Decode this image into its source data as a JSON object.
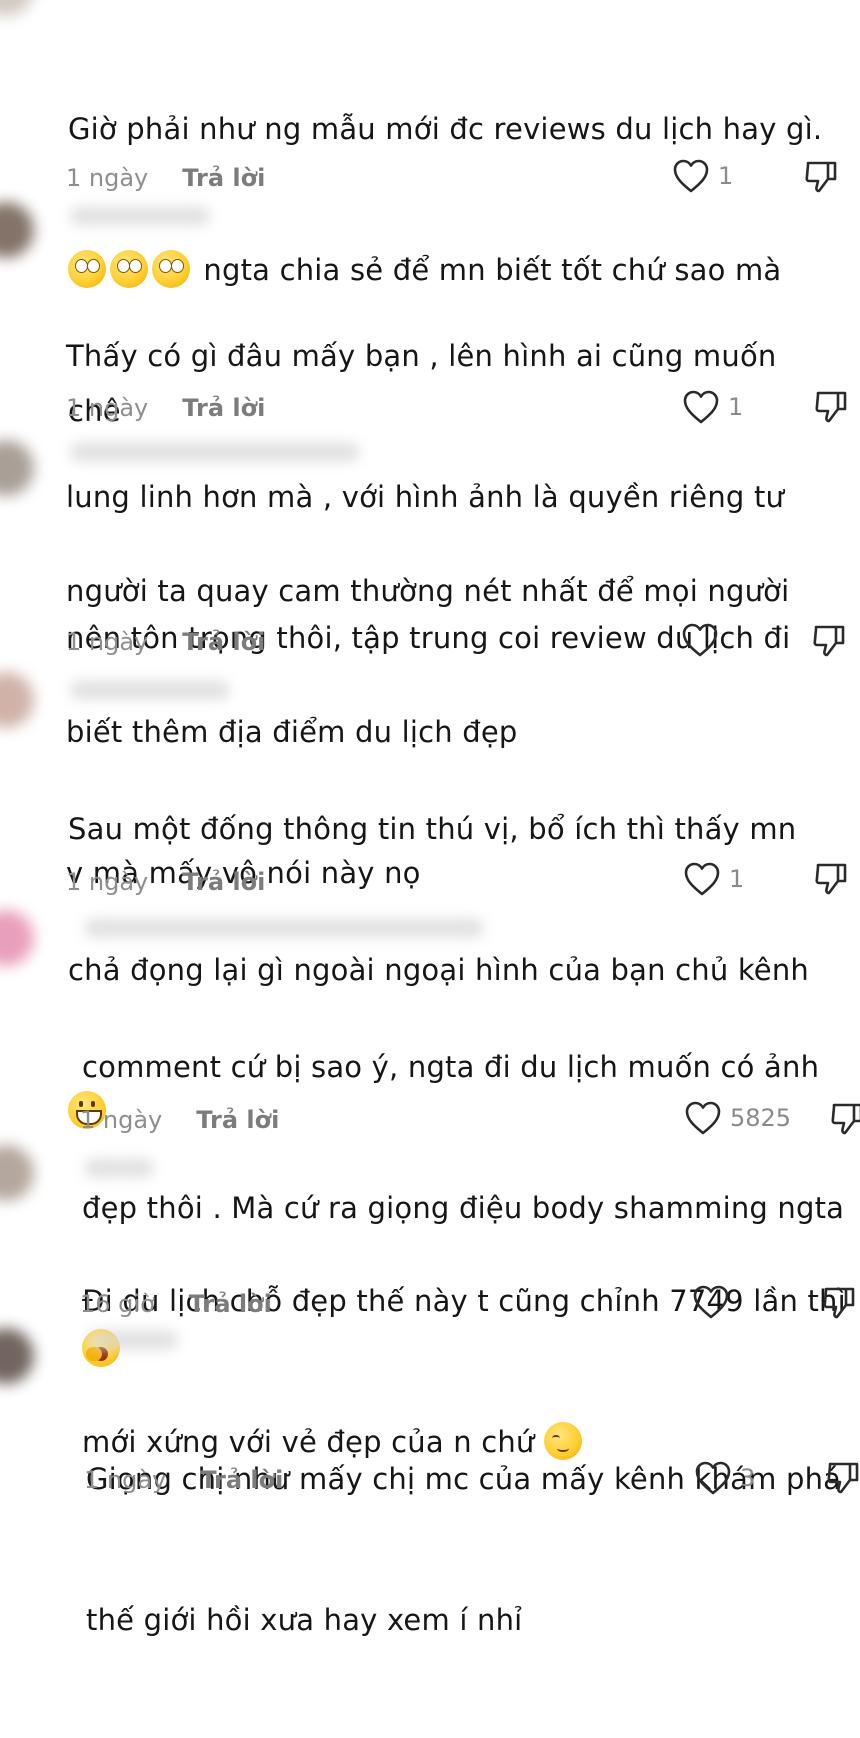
{
  "comments": [
    {
      "lines": [
        "Giờ phải như ng mẫu mới đc reviews du lịch hay gì.",
        "ngta chia sẻ để mn biết tốt chứ sao mà",
        "chê"
      ],
      "emoji_prefix": [
        "face-with-rolling-eyes-emoji",
        "face-with-rolling-eyes-emoji",
        "face-with-rolling-eyes-emoji"
      ],
      "time": "1 ngày",
      "reply": "Trả lời",
      "likes": "1"
    },
    {
      "lines": [
        "Thấy có gì đâu mấy bạn , lên hình ai cũng muốn",
        "lung linh hơn mà , với hình ảnh là quyền riêng tư",
        "nên tôn trọng thôi, tập trung coi review du lịch đi"
      ],
      "time": "1 ngày",
      "reply": "Trả lời",
      "likes": "1"
    },
    {
      "lines": [
        "người ta quay cam thường nét nhất để mọi người",
        "biết thêm địa điểm du lịch đẹp",
        "v mà mấy        vô nói này nọ"
      ],
      "time": "1 ngày",
      "reply": "Trả lời",
      "likes": ""
    },
    {
      "lines": [
        "Sau một đống thông tin thú vị, bổ ích thì thấy mn",
        "chả đọng lại gì ngoài ngoại hình của bạn chủ kênh"
      ],
      "emoji_line": "grinning-face-emoji",
      "time": "1 ngày",
      "reply": "Trả lời",
      "likes": "1"
    },
    {
      "lines": [
        "comment cứ bị sao ý, ngta đi du lịch muốn có ảnh",
        "đẹp thôi . Mà cứ ra giọng điệu body shamming ngta"
      ],
      "emoji_line": "yawning-face-emoji",
      "time": "1 ngày",
      "reply": "Trả lời",
      "likes": "5825"
    },
    {
      "lines": [
        "Đi du lịch chỗ đẹp thế này t cũng chỉnh 7749 lần thì",
        "mới xứng với vẻ đẹp của n chứ"
      ],
      "emoji_suffix": "relieved-face-emoji",
      "time": "16 giờ",
      "reply": "Trả lời",
      "likes": ""
    },
    {
      "lines": [
        "Giọng chị như mấy chị mc của mấy kênh khám phá",
        "thế giới hồi xưa hay xem í nhỉ"
      ],
      "time": "1 ngày",
      "reply": "Trả lời",
      "likes": "3"
    }
  ],
  "colors": {
    "text": "#161616",
    "meta": "#8e8e8e",
    "icon": "#2b2b2b"
  }
}
